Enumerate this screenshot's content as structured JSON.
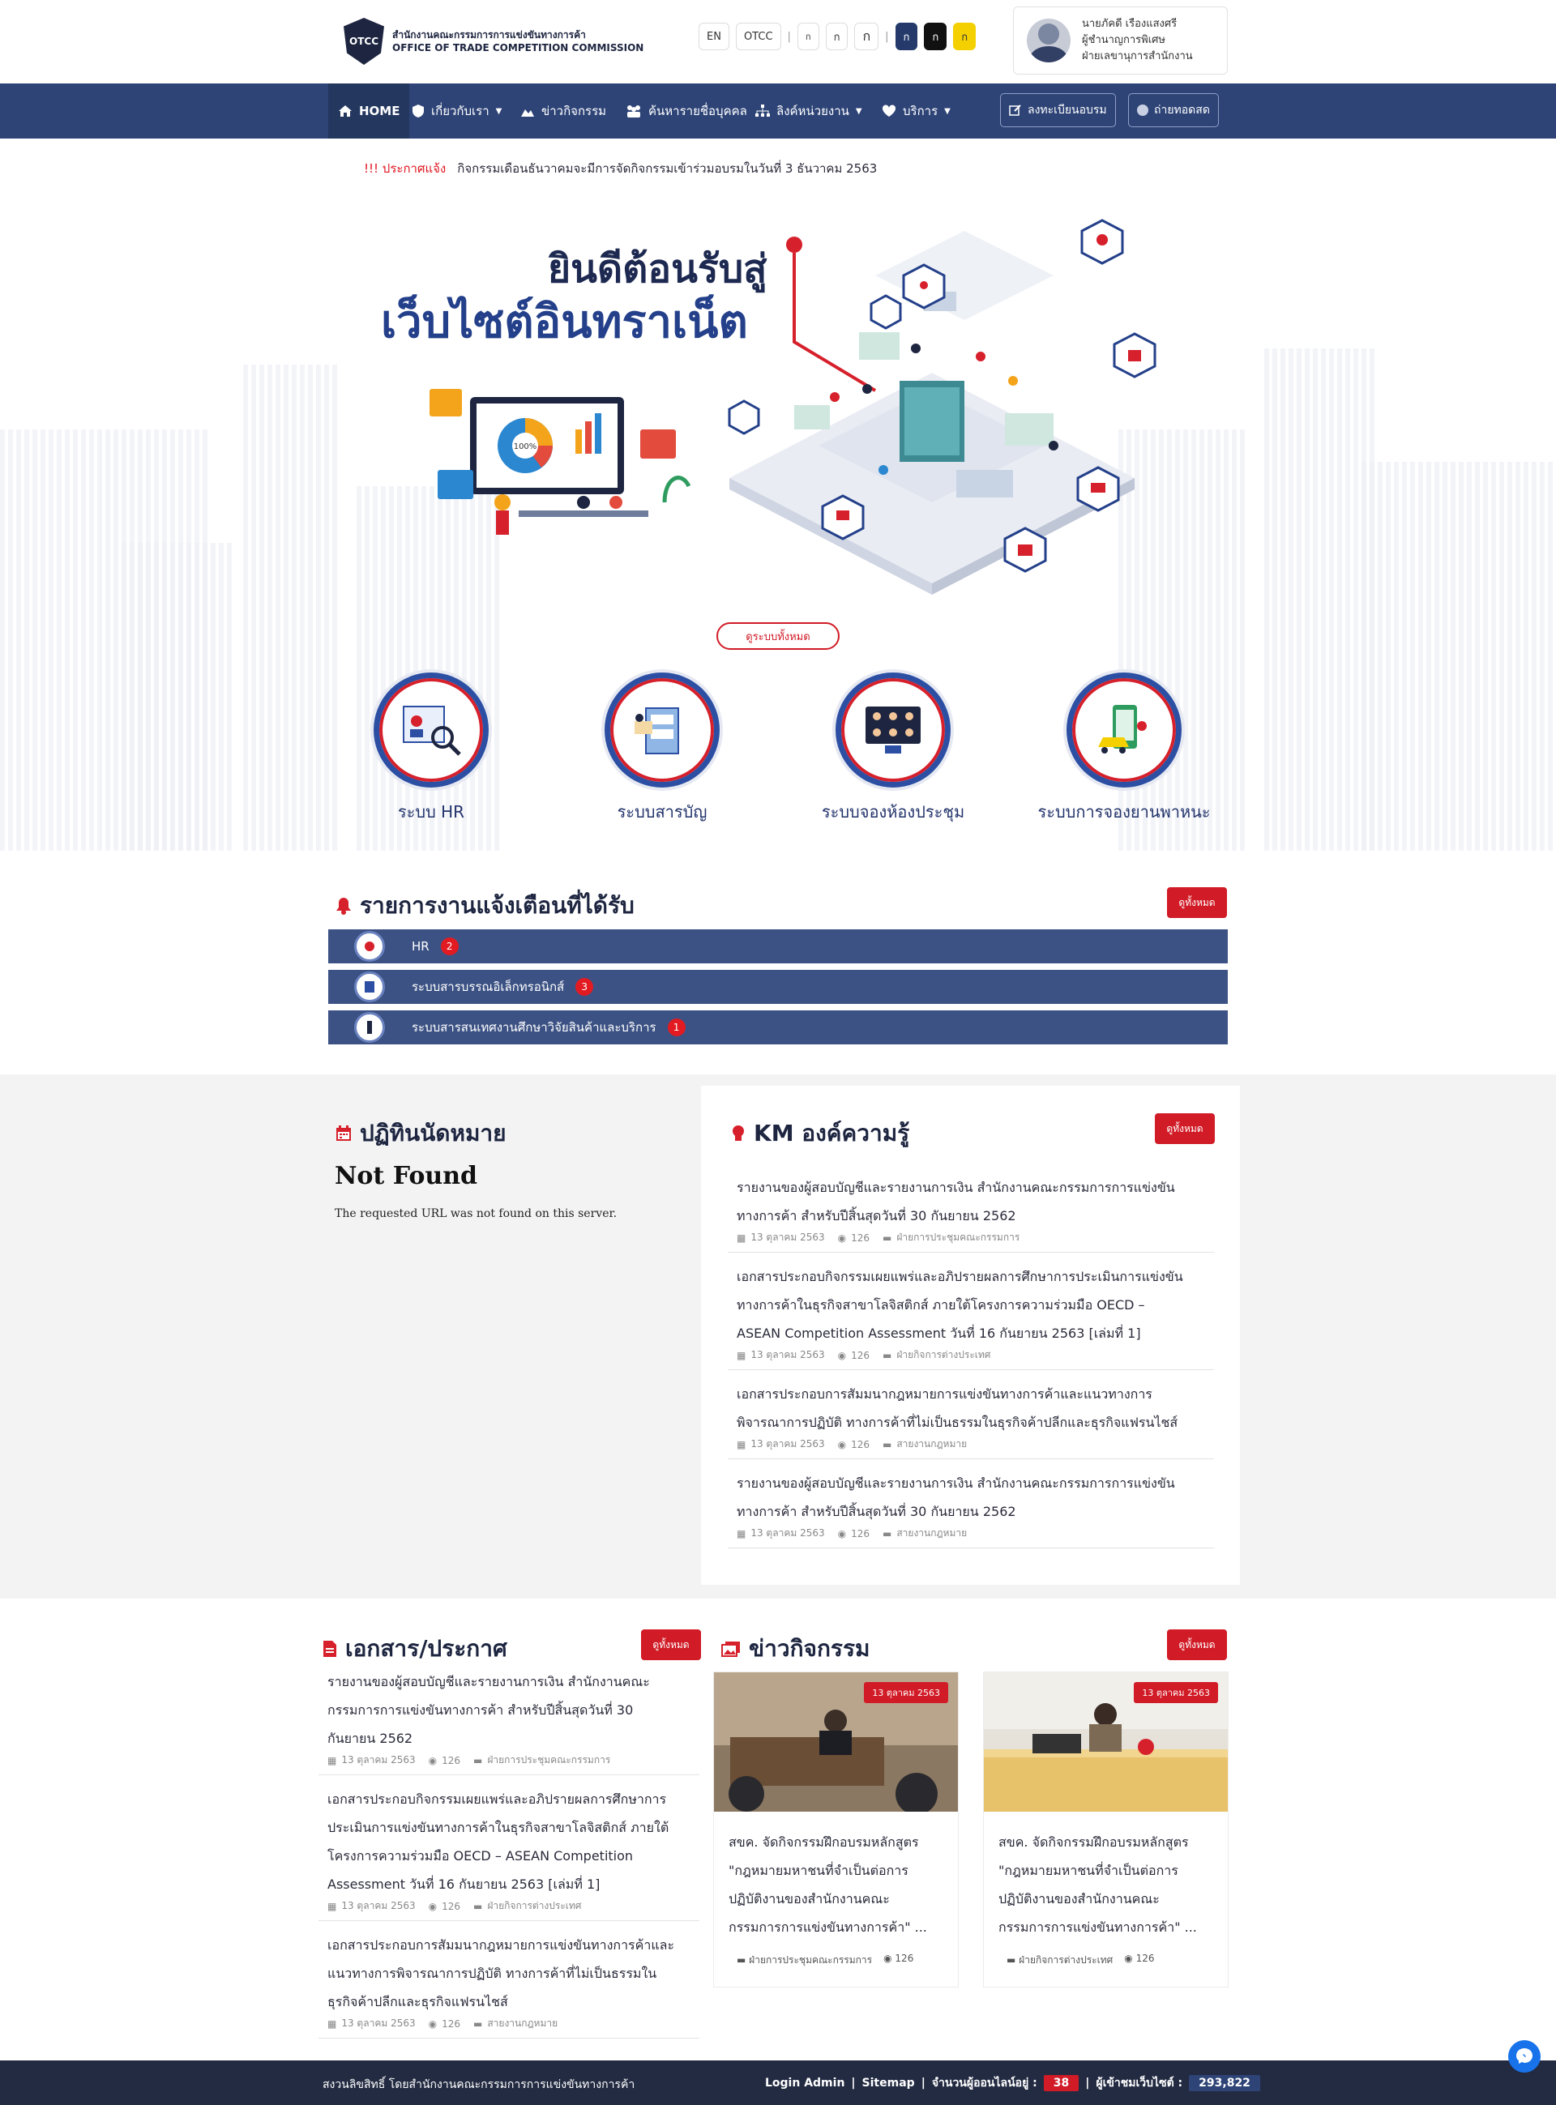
{
  "header": {
    "logo_badge": "OTCC",
    "logo_th": "สำนักงานคณะกรรมการการแข่งขันทางการค้า",
    "logo_en": "OFFICE OF TRADE COMPETITION COMMISSION",
    "lang_buttons": [
      "EN",
      "OTCC",
      "ก",
      "ก",
      "ก",
      "ก",
      "ก"
    ],
    "user_lines": [
      "นายภัคดี เรืองแสงศรี",
      "ผู้ชำนาญการพิเศษ",
      "ฝ่ายเลขานุการสำนักงาน"
    ]
  },
  "nav": {
    "items": [
      "HOME",
      "เกี่ยวกับเรา",
      "ข่าวกิจกรรม",
      "ค้นหารายชื่อบุคคล",
      "ลิงค์หน่วยงาน",
      "บริการ"
    ],
    "register": "ลงทะเบียนอบรม",
    "live": "ถ่ายทอดสด"
  },
  "announcement": {
    "tag": "!!! ประกาศแจ้ง",
    "text": "กิจกรรมเดือนธันวาคมจะมีการจัดกิจกรรมเข้าร่วมอบรมในวันที่ 3 ธันวาคม 2563"
  },
  "hero": {
    "line1": "ยินดีต้อนรับสู่",
    "line2": "เว็บไซต์อินทราเน็ต",
    "all_systems": "ดูระบบทั้งหมด",
    "chart_label": "100%",
    "systems": [
      "ระบบ HR",
      "ระบบสารบัญ",
      "ระบบจองห้องประชุม",
      "ระบบการจองยานพาหนะ"
    ]
  },
  "notifications": {
    "title": "รายการงานแจ้งเตือนที่ได้รับ",
    "view_all": "ดูทั้งหมด",
    "rows": [
      {
        "label": "HR",
        "count": "2"
      },
      {
        "label": "ระบบสารบรรณอิเล็กทรอนิกส์",
        "count": "3"
      },
      {
        "label": "ระบบสารสนเทศงานศึกษาวิจัยสินค้าและบริการ",
        "count": "1"
      }
    ]
  },
  "calendar": {
    "title": "ปฏิทินนัดหมาย",
    "nf_title": "Not Found",
    "nf_text": "The requested URL was not found on this server."
  },
  "km": {
    "title": "KM องค์ความรู้",
    "view_all": "ดูทั้งหมด",
    "items": [
      {
        "lines": [
          "รายงานของผู้สอบบัญชีและรายงานการเงิน สำนักงานคณะกรรมการการแข่งขัน",
          "ทางการค้า สำหรับปีสิ้นสุดวันที่ 30 กันยายน 2562"
        ],
        "date": "13 ตุลาคม 2563",
        "views": "126",
        "dept": "ฝ่ายการประชุมคณะกรรมการ"
      },
      {
        "lines": [
          "เอกสารประกอบกิจกรรมเผยแพร่และอภิปรายผลการศึกษาการประเมินการแข่งขัน",
          "ทางการค้าในธุรกิจสาขาโลจิสติกส์ ภายใต้โครงการความร่วมมือ OECD –",
          "ASEAN Competition Assessment วันที่ 16 กันยายน 2563 [เล่มที่ 1]"
        ],
        "date": "13 ตุลาคม 2563",
        "views": "126",
        "dept": "ฝ่ายกิจการต่างประเทศ"
      },
      {
        "lines": [
          "เอกสารประกอบการสัมมนากฎหมายการแข่งขันทางการค้าและแนวทางการ",
          "พิจารณาการปฏิบัติ ทางการค้าที่ไม่เป็นธรรมในธุรกิจค้าปลีกและธุรกิจแฟรนไชส์"
        ],
        "date": "13 ตุลาคม 2563",
        "views": "126",
        "dept": "สายงานกฎหมาย"
      },
      {
        "lines": [
          "รายงานของผู้สอบบัญชีและรายงานการเงิน สำนักงานคณะกรรมการการแข่งขัน",
          "ทางการค้า สำหรับปีสิ้นสุดวันที่ 30 กันยายน 2562"
        ],
        "date": "13 ตุลาคม 2563",
        "views": "126",
        "dept": "สายงานกฎหมาย"
      }
    ]
  },
  "docs": {
    "title": "เอกสาร/ประกาศ",
    "view_all": "ดูทั้งหมด",
    "items": [
      {
        "lines": [
          "รายงานของผู้สอบบัญชีและรายงานการเงิน สำนักงานคณะ",
          "กรรมการการแข่งขันทางการค้า สำหรับปีสิ้นสุดวันที่ 30",
          "กันยายน 2562"
        ],
        "date": "13 ตุลาคม 2563",
        "views": "126",
        "dept": "ฝ่ายการประชุมคณะกรรมการ"
      },
      {
        "lines": [
          "เอกสารประกอบกิจกรรมเผยแพร่และอภิปรายผลการศึกษาการ",
          "ประเมินการแข่งขันทางการค้าในธุรกิจสาขาโลจิสติกส์ ภายใต้",
          "โครงการความร่วมมือ OECD – ASEAN Competition",
          "Assessment วันที่ 16 กันยายน 2563 [เล่มที่ 1]"
        ],
        "date": "13 ตุลาคม 2563",
        "views": "126",
        "dept": "ฝ่ายกิจการต่างประเทศ"
      },
      {
        "lines": [
          "เอกสารประกอบการสัมมนากฎหมายการแข่งขันทางการค้าและ",
          "แนวทางการพิจารณาการปฏิบัติ ทางการค้าที่ไม่เป็นธรรมใน",
          "ธุรกิจค้าปลีกและธุรกิจแฟรนไชส์"
        ],
        "date": "13 ตุลาคม 2563",
        "views": "126",
        "dept": "สายงานกฎหมาย"
      }
    ]
  },
  "news": {
    "title": "ข่าวกิจกรรม",
    "view_all": "ดูทั้งหมด",
    "cards": [
      {
        "date": "13 ตุลาคม 2563",
        "lines": [
          "สขค. จัดกิจกรรมฝึกอบรมหลักสูตร",
          "\"กฎหมายมหาชนที่จำเป็นต่อการ",
          "ปฏิบัติงานของสำนักงานคณะ",
          "กรรมการการแข่งขันทางการค้า\" ..."
        ],
        "dept": "ฝ่ายการประชุมคณะกรรมการ",
        "views": "126"
      },
      {
        "date": "13 ตุลาคม 2563",
        "lines": [
          "สขค. จัดกิจกรรมฝึกอบรมหลักสูตร",
          "\"กฎหมายมหาชนที่จำเป็นต่อการ",
          "ปฏิบัติงานของสำนักงานคณะ",
          "กรรมการการแข่งขันทางการค้า\" ..."
        ],
        "dept": "ฝ่ายกิจการต่างประเทศ",
        "views": "126"
      }
    ]
  },
  "footer": {
    "copyright": "สงวนลิขสิทธิ์ โดยสำนักงานคณะกรรมการการแข่งขันทางการค้า",
    "login_admin": "Login Admin",
    "sitemap": "Sitemap",
    "online_label": "จำนวนผู้ออนไลน์อยู่ :",
    "online_count": "38",
    "visitors_label": "ผู้เข้าชมเว็บไซต์ :",
    "visitors_count": "293,822",
    "separator": "|"
  },
  "colors": {
    "navy": "#2e4477",
    "red": "#d11b26",
    "dark": "#1d2540"
  }
}
